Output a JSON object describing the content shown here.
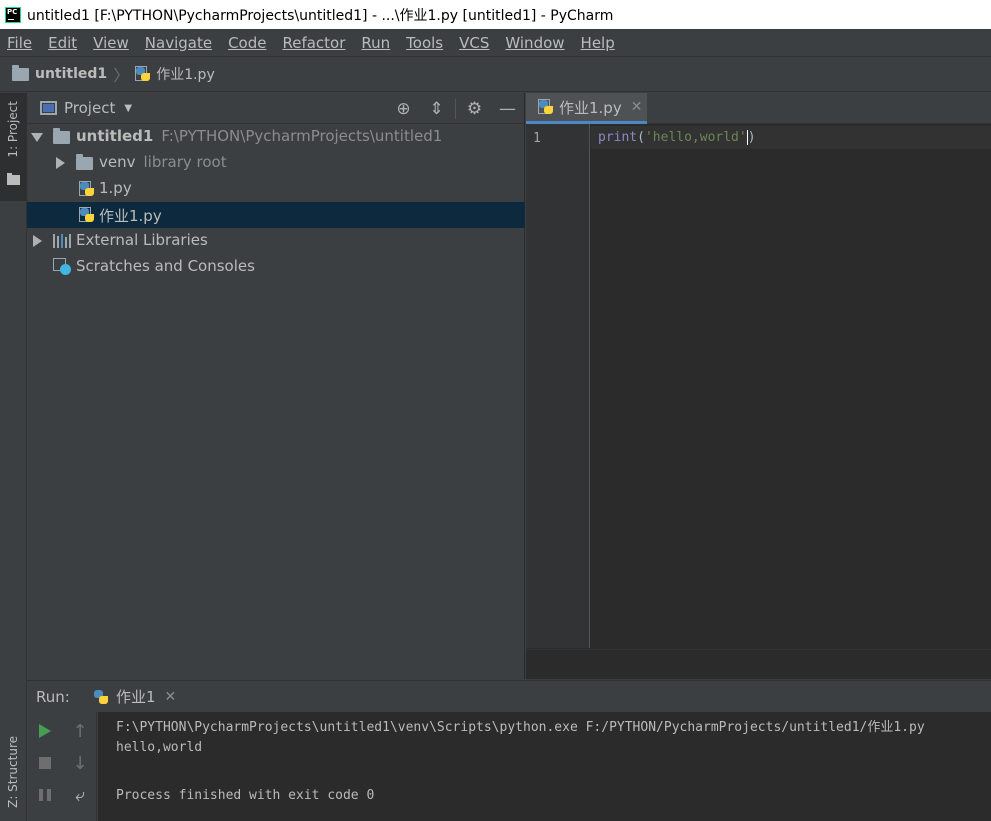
{
  "window": {
    "title": "untitled1 [F:\\PYTHON\\PycharmProjects\\untitled1] - ...\\作业1.py [untitled1] - PyCharm"
  },
  "menu": [
    {
      "label": "File"
    },
    {
      "label": "Edit"
    },
    {
      "label": "View"
    },
    {
      "label": "Navigate"
    },
    {
      "label": "Code"
    },
    {
      "label": "Refactor"
    },
    {
      "label": "Run"
    },
    {
      "label": "Tools"
    },
    {
      "label": "VCS"
    },
    {
      "label": "Window"
    },
    {
      "label": "Help"
    }
  ],
  "breadcrumb": {
    "project": "untitled1",
    "file": "作业1.py"
  },
  "left_strip": {
    "project_tab": "1: Project",
    "structure_tab": "Z: Structure"
  },
  "project_panel": {
    "title": "Project",
    "tree": {
      "root_name": "untitled1",
      "root_path": "F:\\PYTHON\\PycharmProjects\\untitled1",
      "venv_name": "venv",
      "venv_note": "library root",
      "file1": "1.py",
      "file2": "作业1.py",
      "external": "External Libraries",
      "scratches": "Scratches and Consoles"
    }
  },
  "editor": {
    "tab_label": "作业1.py",
    "line_number": "1",
    "code": {
      "fn": "print",
      "open": "(",
      "string": "'hello,world'",
      "close": ")"
    }
  },
  "run": {
    "label": "Run:",
    "tab_label": "作业1",
    "console": [
      "F:\\PYTHON\\PycharmProjects\\untitled1\\venv\\Scripts\\python.exe F:/PYTHON/PycharmProjects/untitled1/作业1.py",
      "hello,world",
      "",
      "Process finished with exit code 0"
    ]
  }
}
